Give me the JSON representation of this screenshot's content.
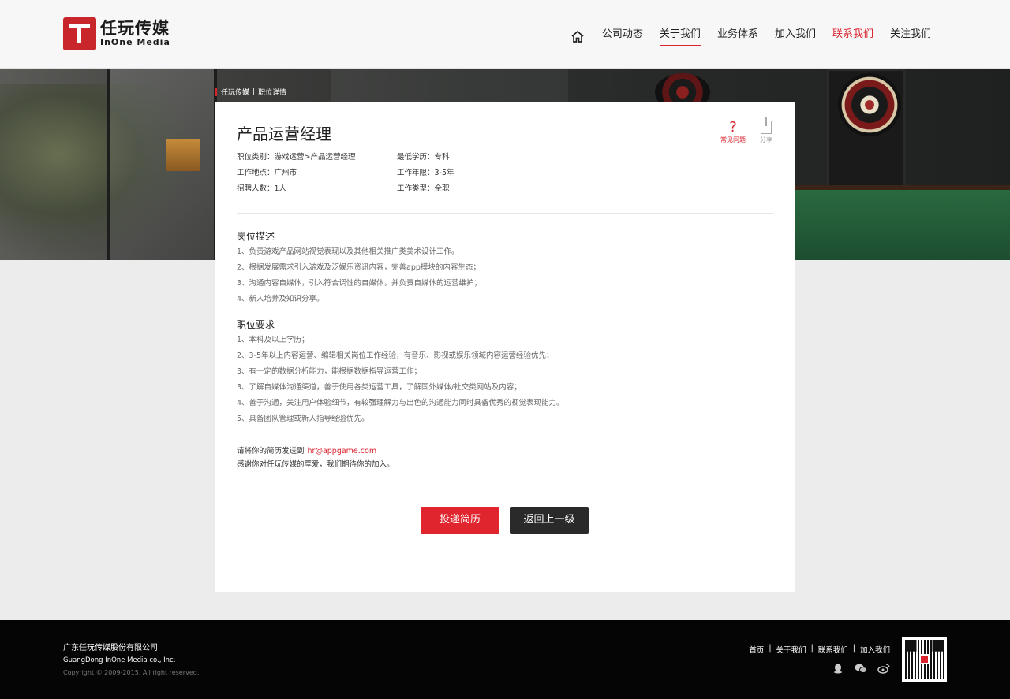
{
  "header": {
    "logo_cn": "任玩传媒",
    "logo_en": "InOne Media",
    "nav": [
      {
        "label": "公司动态"
      },
      {
        "label": "关于我们"
      },
      {
        "label": "业务体系"
      },
      {
        "label": "加入我们"
      },
      {
        "label": "联系我们"
      },
      {
        "label": "关注我们"
      }
    ],
    "active_nav": "关于我们",
    "highlight_nav": "联系我们",
    "accent_color": "#d9232d"
  },
  "breadcrumb": [
    "任玩传媒",
    "职位详情"
  ],
  "job": {
    "title": "产品运营经理",
    "tools": {
      "faq": "常见问题",
      "share": "分享"
    },
    "info": [
      [
        "职位类别：游戏运营>产品运营经理",
        "最低学历：专科"
      ],
      [
        "工作地点：广州市",
        "工作年限：3-5年"
      ],
      [
        "招聘人数：1人",
        "工作类型：全职"
      ]
    ],
    "description_title": "岗位描述",
    "description": [
      "1、负责游戏产品网站视觉表现以及其他相关推广类美术设计工作。",
      "2、根据发展需求引入游戏及泛娱乐资讯内容，完善app模块的内容生态；",
      "3、沟通内容自媒体，引入符合调性的自媒体，并负责自媒体的运营维护；",
      "4、新人培养及知识分享。"
    ],
    "requirements_title": "职位要求",
    "requirements": [
      "1、本科及以上学历；",
      "2、3-5年以上内容运营、编辑相关岗位工作经验，有音乐、影视或娱乐领域内容运营经验优先；",
      "3、有一定的数据分析能力，能根据数据指导运营工作；",
      "3、了解自媒体沟通渠道，善于使用各类运营工具，了解国外媒体/社交类网站及内容；",
      "4、善于沟通，关注用户体验细节，有较强理解力与出色的沟通能力同时具备优秀的视觉表现能力。",
      "5、具备团队管理或新人指导经验优先。"
    ],
    "contact_prefix": "请将你的简历发送到",
    "email": "hr@appgame.com",
    "thanks": "感谢你对任玩传媒的厚爱，我们期待你的加入。",
    "apply_button": "投递简历",
    "back_button": "返回上一级"
  },
  "footer": {
    "company_cn": "广东任玩传媒股份有限公司",
    "company_en": "GuangDong InOne Media co., Inc.",
    "copyright": "Copyright © 2009-2015. All right reserved.",
    "links": [
      "首页",
      "关于我们",
      "联系我们",
      "加入我们"
    ],
    "socials": [
      "qq-icon",
      "wechat-icon",
      "weibo-icon"
    ]
  }
}
